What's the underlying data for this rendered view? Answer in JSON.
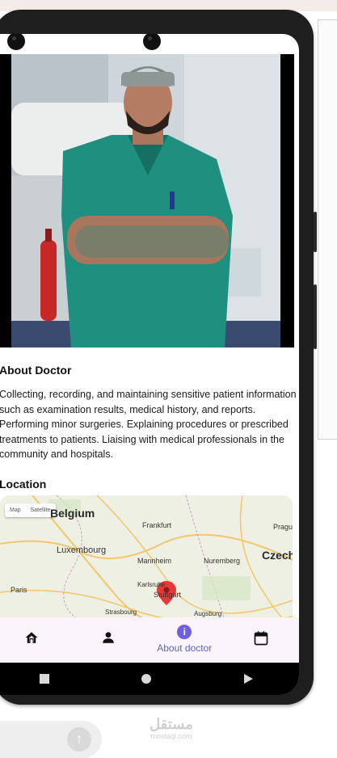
{
  "about": {
    "title": "About Doctor",
    "text": "Collecting, recording, and maintaining sensitive patient information such as examination results, medical history, and reports. Performing minor surgeries. Explaining procedures or prescribed treatments to patients. Liaising with medical professionals in the community and hospitals."
  },
  "location": {
    "title": "Location",
    "map_toggle": [
      "Map",
      "Satellite"
    ],
    "labels": [
      "Belgium",
      "Frankfurt",
      "Prague",
      "Luxembourg",
      "Mannheim",
      "Nuremberg",
      "Czech",
      "Paris",
      "Karlsruhe",
      "Stuttgart",
      "Strasbourg",
      "Augsburg"
    ]
  },
  "bottom_nav": {
    "items": [
      {
        "icon": "home-icon"
      },
      {
        "icon": "person-icon"
      },
      {
        "icon": "info-icon",
        "label": "About doctor",
        "glyph": "i",
        "active": true
      },
      {
        "icon": "calendar-icon"
      }
    ]
  },
  "system_nav": {
    "icons": [
      "recent-apps-icon",
      "home-circle-icon",
      "back-triangle-icon"
    ]
  },
  "watermark": {
    "line1": "مستقل",
    "line2": "mostaql.com"
  },
  "colors": {
    "accent": "#6f5fe0",
    "nav_label": "#5a64b4",
    "scrubs": "#1f8f80",
    "nav_bg": "#fbf5fb"
  }
}
